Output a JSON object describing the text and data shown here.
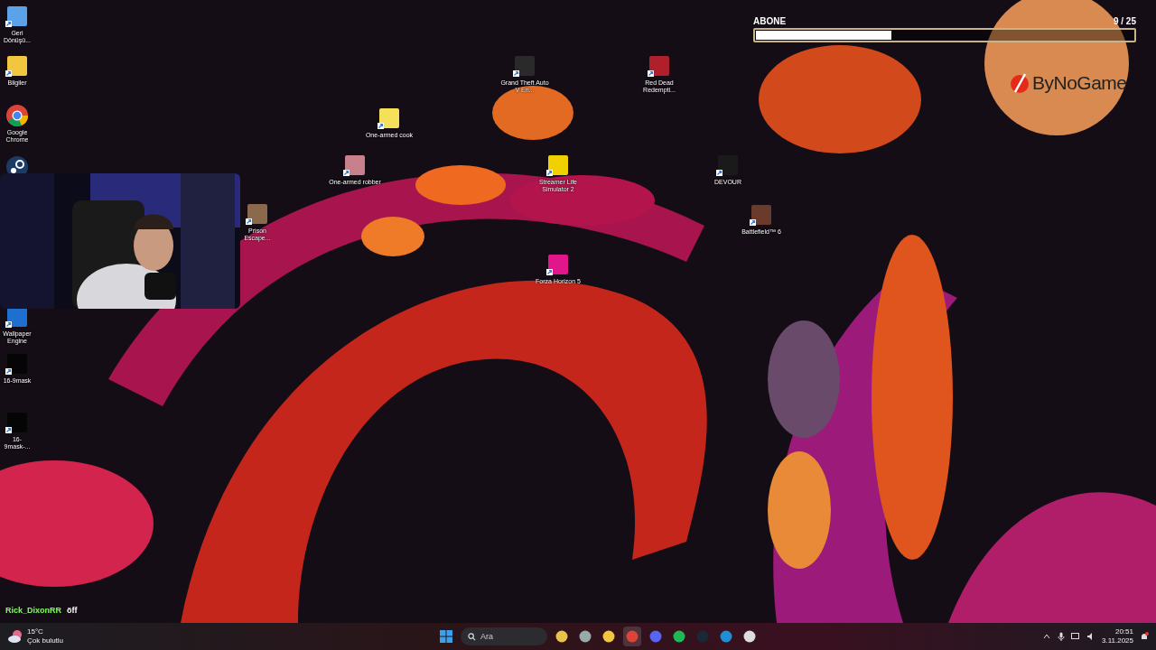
{
  "desktop_icons": [
    {
      "label": "Geri Dönüşü..."
    },
    {
      "label": "Bilgiler"
    },
    {
      "label": "Google Chrome"
    },
    {
      "label": "Wallpaper Engine"
    },
    {
      "label": "16-9mask"
    },
    {
      "label": "16-9mask-..."
    },
    {
      "label": "Prison Escape..."
    },
    {
      "label": "Grand Theft Auto V En..."
    },
    {
      "label": "Red Dead Redempti..."
    },
    {
      "label": "One-armed cook"
    },
    {
      "label": "One-armed robber"
    },
    {
      "label": "Streamer Life Simulator 2"
    },
    {
      "label": "DEVOUR"
    },
    {
      "label": "Battlefield™ 6"
    },
    {
      "label": "Forza Horizon 5"
    }
  ],
  "goal": {
    "title": "ABONE",
    "count": "9 / 25",
    "level": 0.36
  },
  "logo": {
    "text": "ByNoGame"
  },
  "chat": {
    "user": "Rick_DixonRR",
    "message": "öff"
  },
  "taskbar": {
    "weather": {
      "temperature": "15°C",
      "condition": "Çok bulutlu"
    },
    "search": {
      "placeholder": "Ara"
    },
    "apps": [
      {
        "selected": false
      },
      {
        "selected": false
      },
      {
        "selected": false
      },
      {
        "selected": true
      },
      {
        "selected": false
      },
      {
        "selected": false
      },
      {
        "selected": false
      },
      {
        "selected": false
      },
      {
        "selected": false
      }
    ],
    "time": "20:51",
    "date": "3.11.2025"
  }
}
